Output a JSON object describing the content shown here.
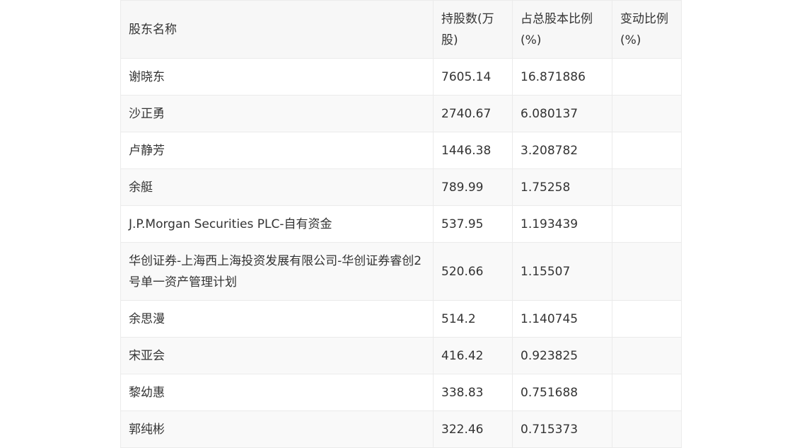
{
  "table": {
    "headers": [
      "股东名称",
      "持股数(万股)",
      "占总股本比例(%)",
      "变动比例(%)"
    ],
    "rows": [
      {
        "name": "谢晓东",
        "shares": "7605.14",
        "ratio": "16.871886",
        "change": ""
      },
      {
        "name": "沙正勇",
        "shares": "2740.67",
        "ratio": "6.080137",
        "change": ""
      },
      {
        "name": "卢静芳",
        "shares": "1446.38",
        "ratio": "3.208782",
        "change": ""
      },
      {
        "name": "余艇",
        "shares": "789.99",
        "ratio": "1.75258",
        "change": ""
      },
      {
        "name": "J.P.Morgan Securities PLC-自有资金",
        "shares": "537.95",
        "ratio": "1.193439",
        "change": ""
      },
      {
        "name": "华创证券-上海西上海投资发展有限公司-华创证券睿创2号单一资产管理计划",
        "shares": "520.66",
        "ratio": "1.15507",
        "change": ""
      },
      {
        "name": "余思漫",
        "shares": "514.2",
        "ratio": "1.140745",
        "change": ""
      },
      {
        "name": "宋亚会",
        "shares": "416.42",
        "ratio": "0.923825",
        "change": ""
      },
      {
        "name": "黎幼惠",
        "shares": "338.83",
        "ratio": "0.751688",
        "change": ""
      },
      {
        "name": "郭纯彬",
        "shares": "322.46",
        "ratio": "0.715373",
        "change": ""
      }
    ]
  }
}
